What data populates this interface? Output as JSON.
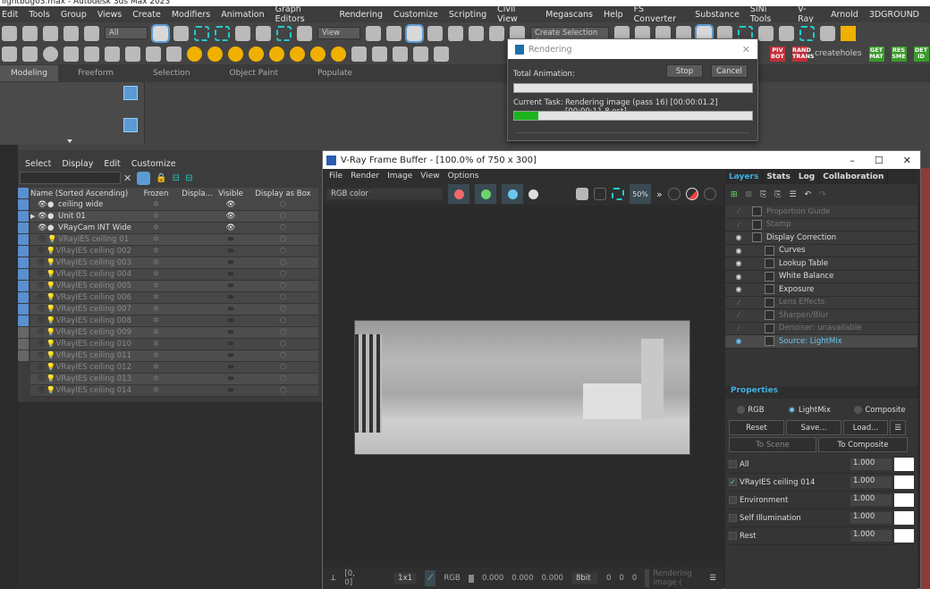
{
  "app": {
    "title": "lightbug03.max - Autodesk 3ds Max 2023"
  },
  "menu": [
    "Edit",
    "Tools",
    "Group",
    "Views",
    "Create",
    "Modifiers",
    "Animation",
    "Graph Editors",
    "Rendering",
    "Customize",
    "Scripting",
    "Civil View",
    "Megascans",
    "Help",
    "FS Converter",
    "Substance",
    "SiNi Tools",
    "V-Ray",
    "Arnold",
    "3DGROUND"
  ],
  "toolbar": {
    "filter_value": "All",
    "view_value": "View",
    "selection_set_placeholder": "Create Selection Set",
    "script_badges": [
      {
        "label": "PIV BOT",
        "color": "#c0303a"
      },
      {
        "label": "RAND TRANS",
        "color": "#c0303a"
      }
    ],
    "createholes": "createholes",
    "green_badges": [
      "GET MAT",
      "RES SME",
      "DET ID"
    ]
  },
  "ribbon": {
    "tabs": [
      "Modeling",
      "Freeform",
      "Selection",
      "Object Paint",
      "Populate"
    ]
  },
  "explorer": {
    "menu": [
      "Select",
      "Display",
      "Edit",
      "Customize"
    ],
    "columns": [
      "Name (Sorted Ascending)",
      "Frozen",
      "Displa...",
      "Visible",
      "Display as Box"
    ],
    "rows": [
      {
        "name": "ceiling wide",
        "visible": true
      },
      {
        "name": "Unit 01",
        "visible": true,
        "expandable": true
      },
      {
        "name": "VRayCam INT Wide",
        "visible": true
      },
      {
        "name": "VRayIES ceiling 01",
        "visible": false
      },
      {
        "name": "VRayIES ceiling 002",
        "visible": false
      },
      {
        "name": "VRayIES ceiling 003",
        "visible": false
      },
      {
        "name": "VRayIES ceiling 004",
        "visible": false
      },
      {
        "name": "VRayIES ceiling 005",
        "visible": false
      },
      {
        "name": "VRayIES ceiling 006",
        "visible": false
      },
      {
        "name": "VRayIES ceiling 007",
        "visible": false
      },
      {
        "name": "VRayIES ceiling 008",
        "visible": false
      },
      {
        "name": "VRayIES ceiling 009",
        "visible": false
      },
      {
        "name": "VRayIES ceiling 010",
        "visible": false
      },
      {
        "name": "VRayIES ceiling 011",
        "visible": false
      },
      {
        "name": "VRayIES ceiling 012",
        "visible": false
      },
      {
        "name": "VRayIES ceiling 013",
        "visible": false
      },
      {
        "name": "VRayIES ceiling 014",
        "visible": false
      }
    ]
  },
  "rendering_dialog": {
    "title": "Rendering",
    "total_label": "Total Animation:",
    "stop": "Stop",
    "cancel": "Cancel",
    "task_label": "Current Task:",
    "task_text": "Rendering image (pass 16) [00:00:01.2] [00:00:11.8 est]",
    "total_progress": 0,
    "task_progress": 0.1,
    "progress_color": "#1db51d"
  },
  "vfb": {
    "title": "V-Ray Frame Buffer - [100.0% of 750 x 300]",
    "menu": [
      "File",
      "Render",
      "Image",
      "View",
      "Options"
    ],
    "channel": "RGB color",
    "zoom_label": "50%",
    "status": {
      "coords": "[0, 0]",
      "sampling": "1x1",
      "rgb_label": "RGB",
      "r": "0.000",
      "g": "0.000",
      "b": "0.000",
      "bit": "8bit",
      "v1": "0",
      "v2": "0",
      "v3": "0",
      "message": "Rendering image ("
    },
    "tabs": [
      "Layers",
      "Stats",
      "Log",
      "Collaboration"
    ],
    "layers": [
      {
        "name": "Proportion Guide",
        "enabled": false,
        "indent": 0
      },
      {
        "name": "Stamp",
        "enabled": false,
        "indent": 0
      },
      {
        "name": "Display Correction",
        "enabled": true,
        "indent": 0
      },
      {
        "name": "Curves",
        "enabled": true,
        "indent": 1
      },
      {
        "name": "Lookup Table",
        "enabled": true,
        "indent": 1
      },
      {
        "name": "White Balance",
        "enabled": true,
        "indent": 1
      },
      {
        "name": "Exposure",
        "enabled": true,
        "indent": 1
      },
      {
        "name": "Lens Effects",
        "enabled": false,
        "indent": 1
      },
      {
        "name": "Sharpen/Blur",
        "enabled": false,
        "indent": 1
      },
      {
        "name": "Denoiser: unavailable",
        "enabled": false,
        "indent": 1
      },
      {
        "name": "Source: LightMix",
        "enabled": true,
        "indent": 1,
        "selected": true
      }
    ],
    "properties": {
      "title": "Properties",
      "modes": [
        "RGB",
        "LightMix",
        "Composite"
      ],
      "selected_mode": "LightMix",
      "reset": "Reset",
      "save": "Save...",
      "load": "Load...",
      "to_scene": "To Scene",
      "to_composite": "To Composite",
      "mix": [
        {
          "name": "All",
          "checked": false,
          "value": "1.000"
        },
        {
          "name": "VRayIES ceiling 014",
          "checked": true,
          "value": "1.000"
        },
        {
          "name": "Environment",
          "checked": false,
          "value": "1.000"
        },
        {
          "name": "Self Illumination",
          "checked": false,
          "value": "1.000"
        },
        {
          "name": "Rest",
          "checked": false,
          "value": "1.000"
        }
      ]
    }
  }
}
